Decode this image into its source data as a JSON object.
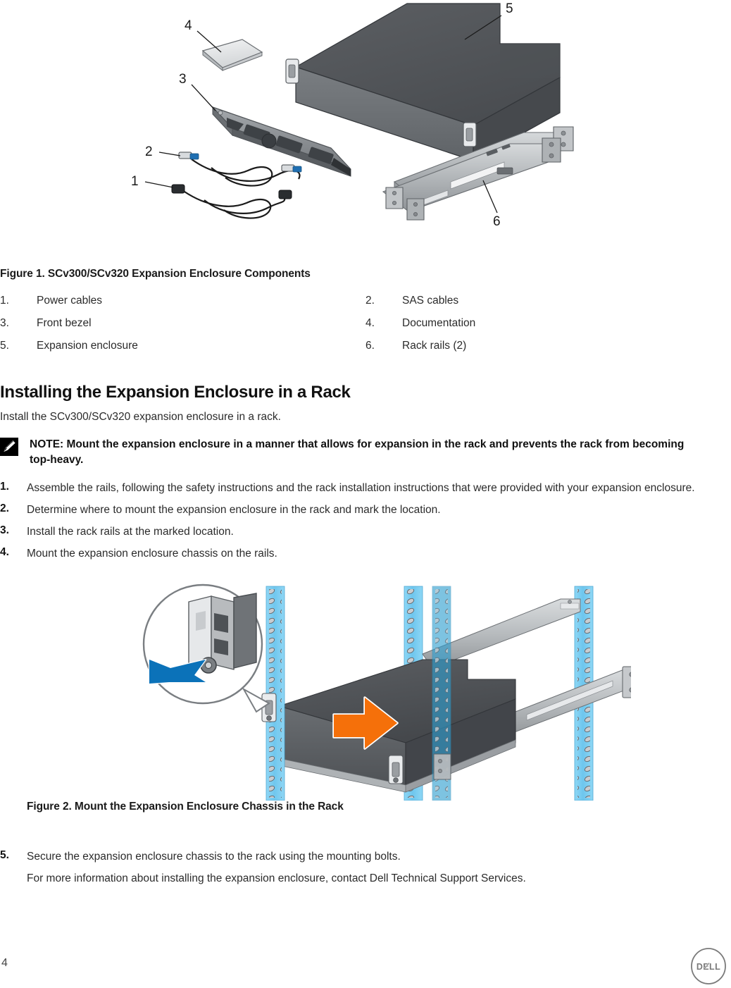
{
  "figure1": {
    "caption": "Figure 1. SCv300/SCv320 Expansion Enclosure Components",
    "callouts": [
      "1",
      "2",
      "3",
      "4",
      "5",
      "6"
    ],
    "legend": [
      {
        "num": "1.",
        "label": "Power cables"
      },
      {
        "num": "2.",
        "label": "SAS cables"
      },
      {
        "num": "3.",
        "label": "Front bezel"
      },
      {
        "num": "4.",
        "label": "Documentation"
      },
      {
        "num": "5.",
        "label": "Expansion enclosure"
      },
      {
        "num": "6.",
        "label": "Rack rails (2)"
      }
    ]
  },
  "section": {
    "title": "Installing the Expansion Enclosure in a Rack",
    "intro": "Install the SCv300/SCv320 expansion enclosure in a rack."
  },
  "note": {
    "text": "NOTE: Mount the expansion enclosure in a manner that allows for expansion in the rack and prevents the rack from becoming top-heavy."
  },
  "steps": [
    {
      "num": "1.",
      "text": "Assemble the rails, following the safety instructions and the rack installation instructions that were provided with your expansion enclosure."
    },
    {
      "num": "2.",
      "text": "Determine where to mount the expansion enclosure in the rack and mark the location."
    },
    {
      "num": "3.",
      "text": "Install the rack rails at the marked location."
    },
    {
      "num": "4.",
      "text": "Mount the expansion enclosure chassis on the rails."
    }
  ],
  "figure2": {
    "caption": "Figure 2. Mount the Expansion Enclosure Chassis in the Rack"
  },
  "step5": {
    "num": "5.",
    "text": "Secure the expansion enclosure chassis to the rack using the mounting bolts.",
    "subtext": "For more information about installing the expansion enclosure, contact Dell Technical Support Services."
  },
  "footer": {
    "page_number": "4",
    "logo_text": "DELL"
  },
  "colors": {
    "chassis_top": "#53565a",
    "chassis_front": "#6d7175",
    "chassis_dark": "#3f4246",
    "rack_post": "#6ec6ee",
    "rack_post_light": "#8ed7f5",
    "arrow_orange": "#f5700a",
    "arrow_blue": "#0b72b9",
    "rail_metal": "#b9bcbf",
    "rail_metal_dark": "#8c9094",
    "bezel": "#8b8f93",
    "text": "#2b2b2b",
    "heading": "#111111",
    "logo_gray": "#7a7a7a"
  }
}
